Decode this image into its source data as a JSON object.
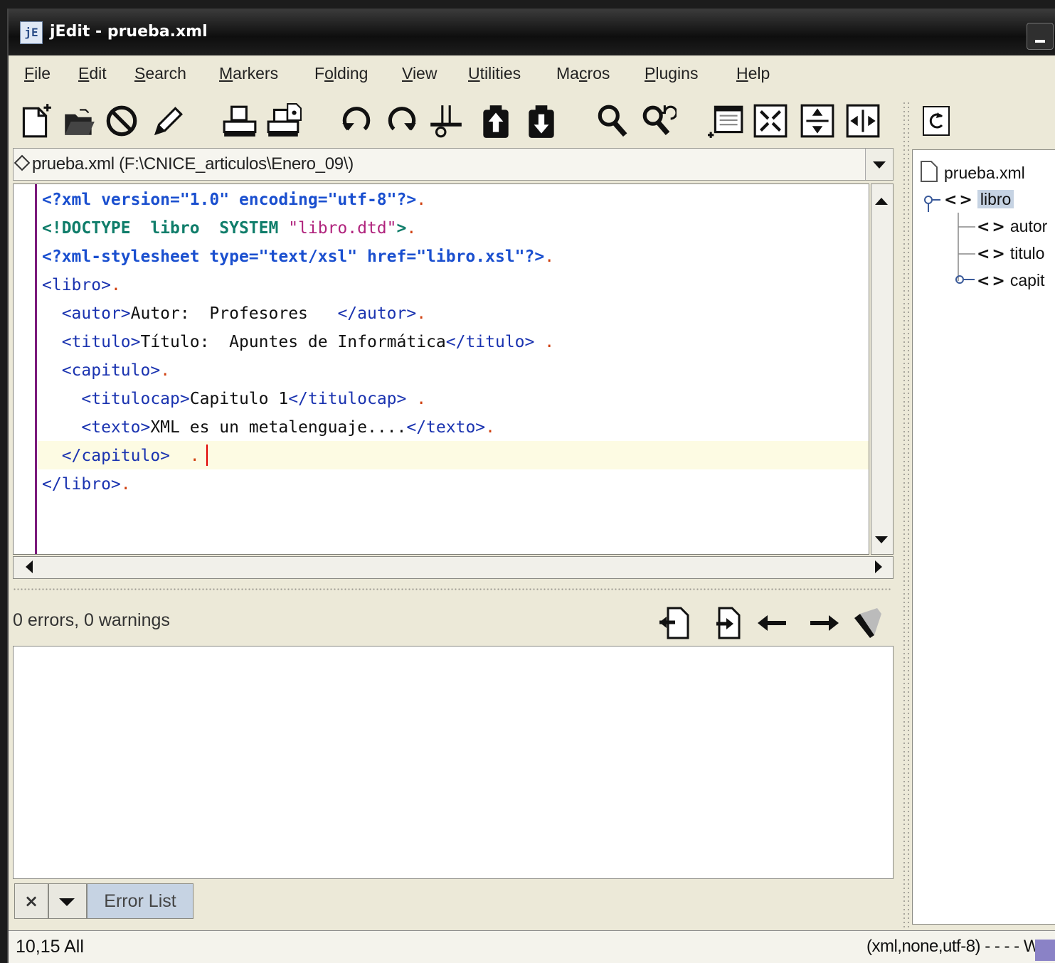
{
  "window": {
    "title": "jEdit - prueba.xml",
    "app_icon": "jE"
  },
  "menu": [
    {
      "label": "File",
      "mn": "F",
      "rest": "ile"
    },
    {
      "label": "Edit",
      "mn": "E",
      "rest": "dit"
    },
    {
      "label": "Search",
      "mn": "S",
      "rest": "earch"
    },
    {
      "label": "Markers",
      "mn": "M",
      "rest": "arkers"
    },
    {
      "label": "Folding",
      "pre": "F",
      "mn": "o",
      "rest": "lding"
    },
    {
      "label": "View",
      "mn": "V",
      "rest": "iew"
    },
    {
      "label": "Utilities",
      "mn": "U",
      "rest": "tilities"
    },
    {
      "label": "Macros",
      "pre": "Ma",
      "mn": "c",
      "rest": "ros"
    },
    {
      "label": "Plugins",
      "mn": "P",
      "rest": "lugins"
    },
    {
      "label": "Help",
      "mn": "H",
      "rest": "elp"
    }
  ],
  "toolbar": {
    "icons": [
      "new-file-icon",
      "open-file-icon",
      "close-file-icon",
      "edit-pencil-icon",
      "print-icon",
      "page-setup-icon",
      "undo-icon",
      "redo-icon",
      "cut-icon",
      "copy-icon",
      "paste-icon",
      "find-icon",
      "find-next-icon",
      "new-view-icon",
      "unsplit-icon",
      "split-horizontal-icon",
      "split-vertical-icon"
    ]
  },
  "buffer": {
    "label": "prueba.xml (F:\\CNICE_articulos\\Enero_09\\)"
  },
  "editor": {
    "caret_line": 10,
    "lines": [
      [
        [
          "kw-blue",
          "<?xml version=\"1.0\" encoding=\"utf-8\"?>"
        ],
        [
          "eol",
          "."
        ]
      ],
      [
        [
          "kw-green",
          "<!DOCTYPE  libro  SYSTEM "
        ],
        [
          "str-mag",
          "\"libro.dtd\""
        ],
        [
          "kw-green",
          ">"
        ],
        [
          "eol",
          "."
        ]
      ],
      [
        [
          "kw-blue",
          "<?xml-stylesheet type=\"text/xsl\" href=\"libro.xsl\"?>"
        ],
        [
          "eol",
          "."
        ]
      ],
      [
        [
          "tag",
          "<libro>"
        ],
        [
          "eol",
          "."
        ]
      ],
      [
        [
          "",
          "  "
        ],
        [
          "tag",
          "<autor>"
        ],
        [
          "",
          "Autor:  Profesores   "
        ],
        [
          "tag",
          "</autor>"
        ],
        [
          "eol",
          "."
        ]
      ],
      [
        [
          "",
          "  "
        ],
        [
          "tag",
          "<titulo>"
        ],
        [
          "",
          "Título:  Apuntes de Informática"
        ],
        [
          "tag",
          "</titulo>"
        ],
        [
          "",
          " "
        ],
        [
          "eol",
          "."
        ]
      ],
      [
        [
          "",
          "  "
        ],
        [
          "tag",
          "<capitulo>"
        ],
        [
          "eol",
          "."
        ]
      ],
      [
        [
          "",
          "    "
        ],
        [
          "tag",
          "<titulocap>"
        ],
        [
          "",
          "Capitulo 1"
        ],
        [
          "tag",
          "</titulocap>"
        ],
        [
          "",
          " "
        ],
        [
          "eol",
          "."
        ]
      ],
      [
        [
          "",
          "    "
        ],
        [
          "tag",
          "<texto>"
        ],
        [
          "",
          "XML es un metalenguaje...."
        ],
        [
          "tag",
          "</texto>"
        ],
        [
          "eol",
          "."
        ]
      ],
      [
        [
          "",
          "  "
        ],
        [
          "tag",
          "</capitulo>"
        ],
        [
          "",
          "  "
        ],
        [
          "eol",
          "."
        ]
      ],
      [
        [
          "tag",
          "</libro>"
        ],
        [
          "eol",
          "."
        ]
      ]
    ]
  },
  "error_list": {
    "summary": "0 errors, 0 warnings",
    "tool_icons": [
      "previous-file-icon",
      "next-file-icon",
      "previous-error-icon",
      "next-error-icon",
      "clear-icon"
    ],
    "tab_label": "Error List",
    "close_glyph": "×"
  },
  "status": {
    "position": "10,15 All",
    "mode": "(xml,none,utf-8) - - - - W"
  },
  "sidekick": {
    "nodes": [
      {
        "label": "prueba.xml",
        "icon": "file-icon"
      },
      {
        "label": "libro",
        "icon": "element-icon"
      },
      {
        "label": "autor",
        "icon": "element-icon"
      },
      {
        "label": "titulo",
        "icon": "element-icon"
      },
      {
        "label": "capit",
        "icon": "element-icon"
      }
    ],
    "angle_glyph": "<>"
  }
}
